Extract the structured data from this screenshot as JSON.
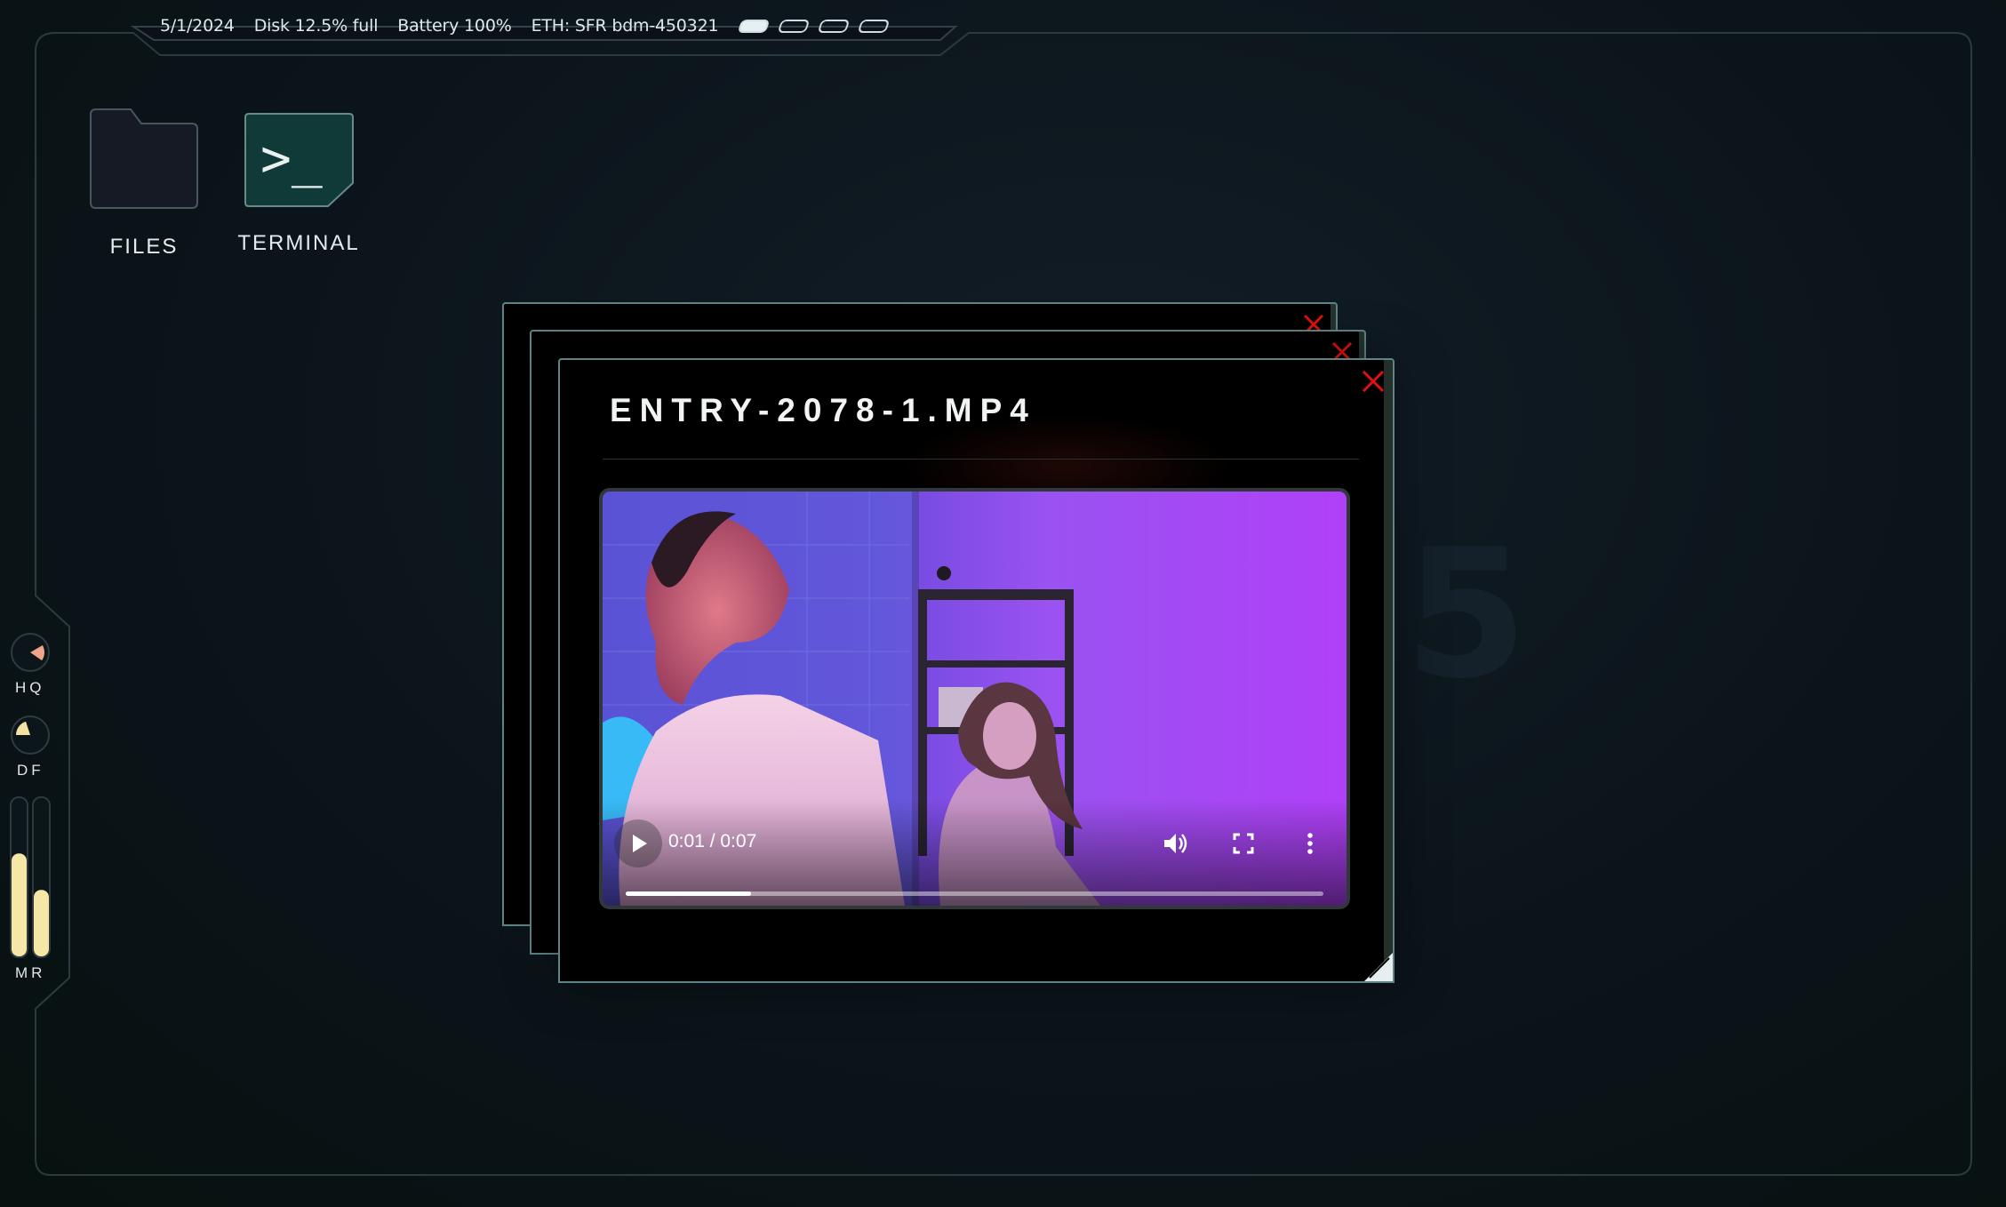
{
  "statusbar": {
    "date": "5/1/2024",
    "disk": "Disk 12.5% full",
    "battery": "Battery 100%",
    "network": "ETH: SFR bdm-450321",
    "workspaces": [
      true,
      false,
      false,
      false
    ]
  },
  "desktop": {
    "files_label": "FILES",
    "terminal_label": "TERMINAL",
    "terminal_prompt": ">_"
  },
  "gauges": {
    "hq_label": "HQ",
    "df_label": "DF",
    "mr_label": "MR",
    "hq_level": 0.18,
    "df_level": 0.2,
    "mr_levels": [
      0.65,
      0.42
    ],
    "colors": {
      "hq": "#f0a48c",
      "df": "#f3e3a0",
      "mr": "#f5e7a6"
    }
  },
  "window": {
    "title": "ENTRY-2078-1.MP4",
    "close_color": "#e01010",
    "border_color": "#5f8487"
  },
  "video": {
    "time_display": "0:01 / 0:07",
    "progress": 0.18
  }
}
